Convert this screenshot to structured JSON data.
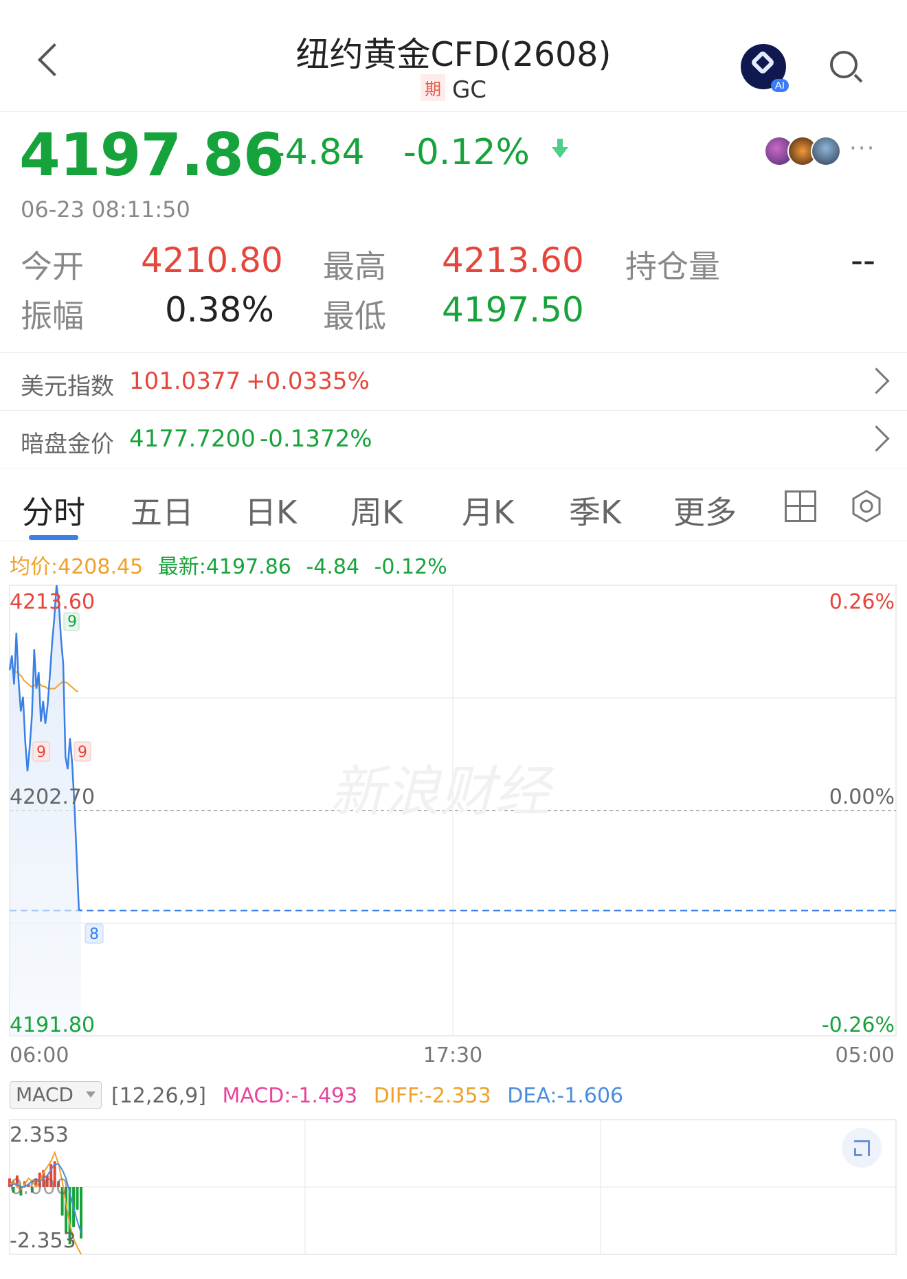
{
  "header": {
    "title": "纽约黄金CFD(2608)",
    "period_badge": "期",
    "symbol": "GC",
    "ai_badge": "AI"
  },
  "quote": {
    "price": "4197.86",
    "change": "-4.84",
    "change_pct": "-0.12%",
    "more": "···",
    "timestamp": "06-23 08:11:50"
  },
  "stats": {
    "open_label": "今开",
    "open_value": "4210.80",
    "high_label": "最高",
    "high_value": "4213.60",
    "oi_label": "持仓量",
    "oi_value": "--",
    "amp_label": "振幅",
    "amp_value": "0.38%",
    "low_label": "最低",
    "low_value": "4197.50"
  },
  "related": [
    {
      "label": "美元指数",
      "value": "101.0377",
      "change": "+0.0335%"
    },
    {
      "label": "暗盘金价",
      "value": "4177.7200",
      "change": "-0.1372%"
    }
  ],
  "tabs": [
    "分时",
    "五日",
    "日K",
    "周K",
    "月K",
    "季K",
    "更多"
  ],
  "chart_info": {
    "avg": "均价:4208.45",
    "latest": "最新:4197.86",
    "change": "-4.84",
    "change_pct": "-0.12%"
  },
  "chart_data": {
    "type": "line",
    "y_max_label": "4213.60",
    "y_mid_label": "4202.70",
    "y_min_label": "4191.80",
    "pct_max_label": "0.26%",
    "pct_mid_label": "0.00%",
    "pct_min_label": "-0.26%",
    "x_labels": [
      "06:00",
      "17:30",
      "05:00"
    ],
    "ylim": [
      4191.8,
      4213.6
    ],
    "prev_close": 4202.7,
    "latest": 4197.86,
    "watermark": "新浪财经",
    "markers": [
      "9",
      "9",
      "9",
      "8"
    ],
    "price_series": [
      4209.5,
      4210.2,
      4208.8,
      4211.3,
      4209.0,
      4207.5,
      4208.2,
      4206.0,
      4204.6,
      4205.8,
      4207.3,
      4210.5,
      4208.6,
      4209.4,
      4207.0,
      4208.0,
      4206.9,
      4207.8,
      4209.2,
      4210.8,
      4212.0,
      4213.6,
      4212.8,
      4211.0,
      4209.8,
      4205.3,
      4204.7,
      4206.2,
      4205.0,
      4203.0,
      4200.5,
      4197.9,
      4197.86
    ],
    "avg_series": [
      4209.8,
      4209.6,
      4209.4,
      4209.4,
      4209.3,
      4209.2,
      4209.0,
      4208.9,
      4208.8,
      4208.7,
      4208.7,
      4208.8,
      4208.8,
      4208.8,
      4208.7,
      4208.7,
      4208.6,
      4208.6,
      4208.6,
      4208.6,
      4208.7,
      4208.8,
      4208.9,
      4208.9,
      4208.9,
      4208.8,
      4208.7,
      4208.6,
      4208.5,
      4208.45
    ]
  },
  "macd": {
    "indicator": "MACD",
    "params": "[12,26,9]",
    "macd_label": "MACD:-1.493",
    "diff_label": "DIFF:-2.353",
    "dea_label": "DEA:-1.606",
    "top_label": "2.353",
    "mid_label": "0.000",
    "bottom_label": "-2.353",
    "colors": {
      "macd": "#e8459a",
      "diff": "#f0a12a",
      "dea": "#4a8de0",
      "up": "#e5463b",
      "down": "#17a33b"
    },
    "histogram": [
      0.3,
      -0.2,
      0.4,
      -0.3,
      0.2,
      0.1,
      -0.2,
      0.3,
      0.5,
      0.6,
      0.4,
      0.8,
      0.9,
      0.2,
      -1.0,
      -1.6,
      -2.0,
      -1.4,
      -0.8,
      -1.8
    ],
    "diff": [
      0.1,
      0.2,
      0.0,
      -0.1,
      0.1,
      0.3,
      0.2,
      0.0,
      0.2,
      0.5,
      0.7,
      0.9,
      1.2,
      0.8,
      0.2,
      -0.6,
      -1.3,
      -1.8,
      -2.1,
      -2.353
    ],
    "dea": [
      0.0,
      0.1,
      0.1,
      0.0,
      0.0,
      0.1,
      0.2,
      0.2,
      0.2,
      0.3,
      0.4,
      0.6,
      0.8,
      0.8,
      0.6,
      0.3,
      -0.2,
      -0.7,
      -1.2,
      -1.606
    ]
  },
  "colors": {
    "up": "#e5463b",
    "down": "#17a33b",
    "line": "#3a80e6",
    "avg": "#f0a12a"
  }
}
